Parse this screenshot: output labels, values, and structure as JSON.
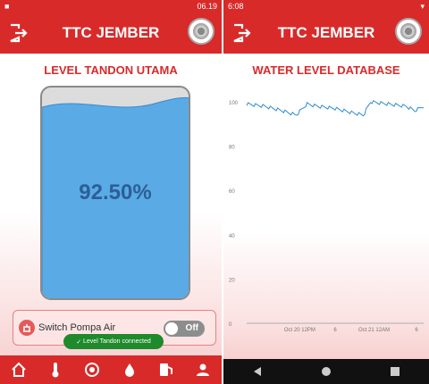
{
  "left": {
    "status": {
      "time": "06.19"
    },
    "appbar": {
      "title": "TTC JEMBER"
    },
    "heading": "LEVEL TANDON UTAMA",
    "tank": {
      "level_text": "92.50%",
      "level_fraction": 0.925
    },
    "switch": {
      "label": "Switch Pompa Air",
      "state": "Off"
    },
    "toast": "Level Tandon connected",
    "nav": [
      "home-icon",
      "thermometer-icon",
      "gauge-icon",
      "water-drop-icon",
      "fuel-pump-icon",
      "user-icon"
    ]
  },
  "right": {
    "status": {
      "time": "6:08"
    },
    "appbar": {
      "title": "TTC JEMBER"
    },
    "heading": "WATER LEVEL DATABASE",
    "nav": [
      "back-icon",
      "home-circle-icon",
      "recents-icon"
    ]
  },
  "chart_data": {
    "type": "line",
    "title": "",
    "xlabel": "",
    "ylabel": "",
    "ylim": [
      0,
      100
    ],
    "yticks": [
      0,
      20,
      40,
      60,
      80,
      100
    ],
    "xtick_labels": [
      "Oct 20 12PM",
      "6",
      "Oct 21 12AM",
      "6"
    ],
    "x": [
      0,
      0.1,
      0.2,
      0.28,
      0.34,
      0.4,
      0.5,
      0.6,
      0.66,
      0.7,
      0.8,
      0.9,
      0.95,
      1.0
    ],
    "series": [
      {
        "values": [
          99,
          98,
          96,
          94,
          99,
          98,
          97,
          95,
          94,
          100,
          99,
          98,
          96,
          98
        ]
      }
    ],
    "colors": {
      "line": "#2e8bd0"
    }
  }
}
